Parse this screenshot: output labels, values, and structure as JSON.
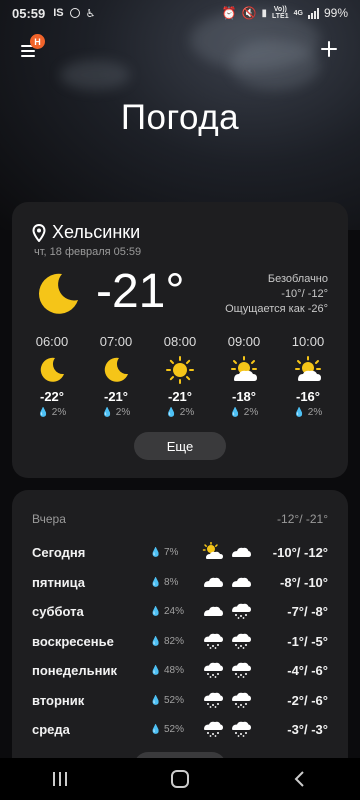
{
  "status_bar": {
    "time": "05:59",
    "left_labels": [
      "IS"
    ],
    "network_top": "Vo))",
    "network_bottom": "LTE1",
    "network_type": "4G",
    "battery": "99%"
  },
  "header": {
    "badge": "Н",
    "title": "Погода"
  },
  "current": {
    "location": "Хельсинки",
    "date": "чт, 18 февраля 05:59",
    "temp": "-21°",
    "condition": "Безоблачно",
    "range": "-10°/ -12°",
    "feels_like": "Ощущается как -26°",
    "icon": "moon-icon"
  },
  "hourly": [
    {
      "time": "06:00",
      "icon": "moon-icon",
      "temp": "-22°",
      "precip": "2%"
    },
    {
      "time": "07:00",
      "icon": "moon-icon",
      "temp": "-21°",
      "precip": "2%"
    },
    {
      "time": "08:00",
      "icon": "sun-icon",
      "temp": "-21°",
      "precip": "2%"
    },
    {
      "time": "09:00",
      "icon": "sun-cloud-icon",
      "temp": "-18°",
      "precip": "2%"
    },
    {
      "time": "10:00",
      "icon": "sun-cloud-icon",
      "temp": "-16°",
      "precip": "2%"
    }
  ],
  "more_button": "Еще",
  "yesterday": {
    "label": "Вчера",
    "temp": "-12°/ -21°"
  },
  "daily": [
    {
      "day": "Сегодня",
      "precip": "7%",
      "icons": [
        "sun-cloud-icon",
        "cloud-icon"
      ],
      "temp": "-10°/ -12°"
    },
    {
      "day": "пятница",
      "precip": "8%",
      "icons": [
        "cloud-icon",
        "cloud-icon"
      ],
      "temp": "-8°/ -10°"
    },
    {
      "day": "суббота",
      "precip": "24%",
      "icons": [
        "cloud-icon",
        "snow-cloud-icon"
      ],
      "temp": "-7°/ -8°"
    },
    {
      "day": "воскресенье",
      "precip": "82%",
      "icons": [
        "snow-cloud-icon",
        "snow-cloud-icon"
      ],
      "temp": "-1°/ -5°"
    },
    {
      "day": "понедельник",
      "precip": "48%",
      "icons": [
        "snow-cloud-icon",
        "snow-cloud-icon"
      ],
      "temp": "-4°/ -6°"
    },
    {
      "day": "вторник",
      "precip": "52%",
      "icons": [
        "snow-cloud-icon",
        "snow-cloud-icon"
      ],
      "temp": "-2°/ -6°"
    },
    {
      "day": "среда",
      "precip": "52%",
      "icons": [
        "snow-cloud-icon",
        "snow-cloud-icon"
      ],
      "temp": "-3°/ -3°"
    }
  ],
  "colors": {
    "sun": "#f5c518",
    "moon": "#f5c518",
    "accent_badge": "#f0632a",
    "card": "#1e1e20"
  }
}
